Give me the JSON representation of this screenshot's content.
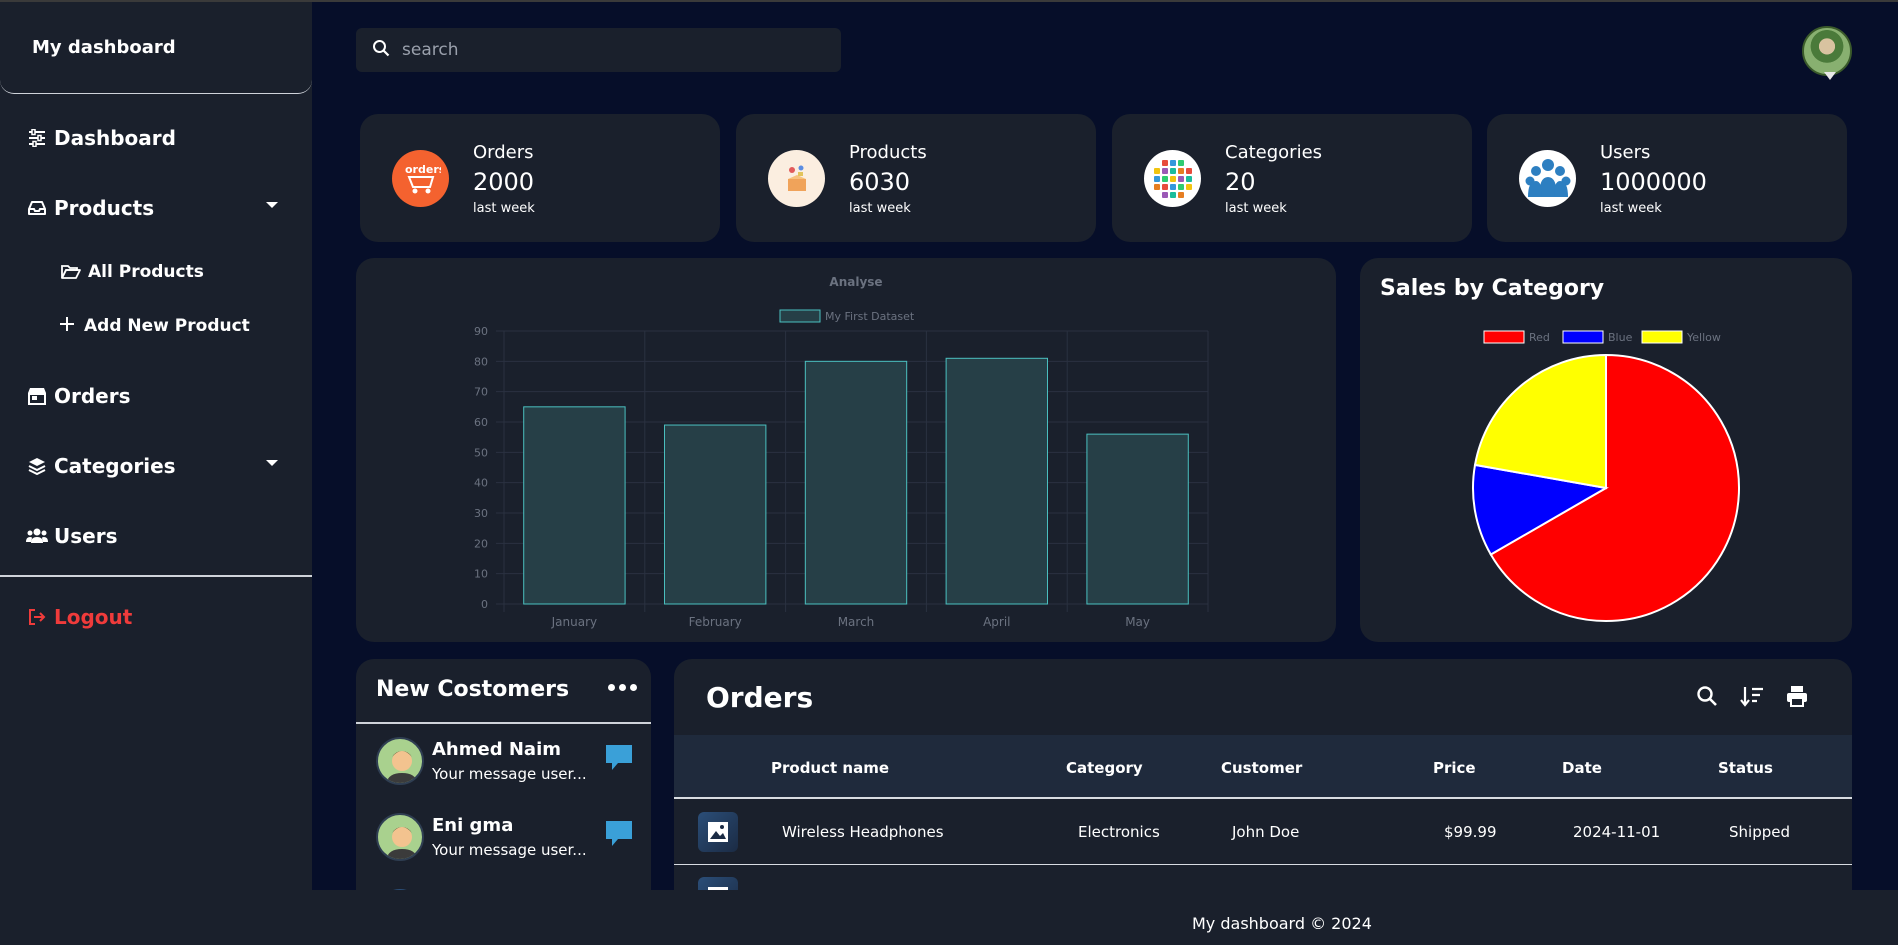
{
  "sidebar": {
    "brand": "My dashboard",
    "items": [
      {
        "label": "Dashboard",
        "icon": "sliders-icon"
      },
      {
        "label": "Products",
        "icon": "inbox-icon"
      },
      {
        "label": "Orders",
        "icon": "store-icon"
      },
      {
        "label": "Categories",
        "icon": "layers-icon"
      },
      {
        "label": "Users",
        "icon": "users-icon"
      }
    ],
    "sub_items": [
      {
        "label": "All Products",
        "icon": "folder-open-icon"
      },
      {
        "label": "Add New Product",
        "icon": "plus-icon"
      }
    ],
    "logout": "Logout"
  },
  "search": {
    "placeholder": "search",
    "value": ""
  },
  "stats": [
    {
      "label": "Orders",
      "value": "2000",
      "sub": "last week",
      "icon": "orders-cart-icon"
    },
    {
      "label": "Products",
      "value": "6030",
      "sub": "last week",
      "icon": "products-box-icon"
    },
    {
      "label": "Categories",
      "value": "20",
      "sub": "last week",
      "icon": "categories-grid-icon"
    },
    {
      "label": "Users",
      "value": "1000000",
      "sub": "last week",
      "icon": "users-group-icon"
    }
  ],
  "chart_data": [
    {
      "type": "bar",
      "title": "Analyse",
      "categories": [
        "January",
        "February",
        "March",
        "April",
        "May"
      ],
      "series": [
        {
          "name": "My First Dataset",
          "values": [
            65,
            59,
            80,
            81,
            56
          ]
        }
      ],
      "ylim": [
        0,
        90
      ],
      "yticks": [
        0,
        10,
        20,
        30,
        40,
        50,
        60,
        70,
        80,
        90
      ],
      "grid": true,
      "legend": "top",
      "colors": {
        "fill": "#263f47",
        "stroke": "#4bc0c0"
      }
    },
    {
      "type": "pie",
      "title": "Sales by Category",
      "labels": [
        "Red",
        "Blue",
        "Yellow"
      ],
      "values": [
        300,
        50,
        100
      ],
      "colors": [
        "#ff0000",
        "#0000ff",
        "#ffff00"
      ],
      "legend": "top"
    }
  ],
  "customers": {
    "title": "New Costomers",
    "items": [
      {
        "name": "Ahmed Naim",
        "message": "Your message user..."
      },
      {
        "name": "Eni gma",
        "message": "Your message user..."
      }
    ]
  },
  "orders": {
    "title": "Orders",
    "columns": [
      "Product name",
      "Category",
      "Customer",
      "Price",
      "Date",
      "Status"
    ],
    "rows": [
      {
        "product": "Wireless Headphones",
        "category": "Electronics",
        "customer": "John Doe",
        "price": "$99.99",
        "date": "2024-11-01",
        "status": "Shipped"
      }
    ]
  },
  "footer": {
    "text": "My dashboard © 2024"
  },
  "colors": {
    "bg": "#060e29",
    "panel": "#1a202c",
    "logout": "#ef3b3b",
    "chat": "#3aa0d8"
  }
}
